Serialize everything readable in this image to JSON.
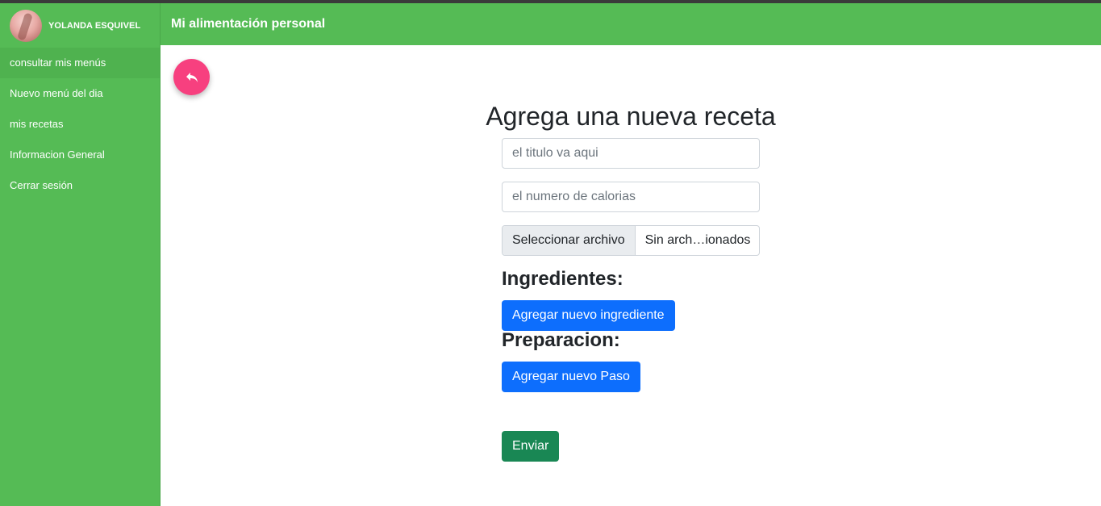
{
  "user": {
    "name": "YOLANDA ESQUIVEL"
  },
  "sidebar": {
    "items": [
      {
        "label": "consultar mis menús",
        "active": true
      },
      {
        "label": "Nuevo menú del dia",
        "active": false
      },
      {
        "label": "mis recetas",
        "active": false
      },
      {
        "label": "Informacion General",
        "active": false
      },
      {
        "label": "Cerrar sesión",
        "active": false
      }
    ]
  },
  "header": {
    "title": "Mi alimentación personal"
  },
  "back_button": {
    "icon": "reply-icon",
    "color": "#f7407f"
  },
  "form": {
    "title": "Agrega una nueva receta",
    "title_placeholder": "el titulo va aqui",
    "calorias_placeholder": "el numero de calorias",
    "file_button_label": "Seleccionar archivo",
    "file_status": "Sin arch…ionados",
    "ingredientes_label": "Ingredientes:",
    "add_ingredient_label": "Agregar nuevo ingrediente",
    "preparacion_label": "Preparacion:",
    "add_step_label": "Agregar nuevo Paso",
    "submit_label": "Enviar"
  },
  "colors": {
    "brand_green": "#55bb55",
    "primary_blue": "#0d6efd",
    "success_green": "#198754",
    "accent_pink": "#f7407f"
  }
}
